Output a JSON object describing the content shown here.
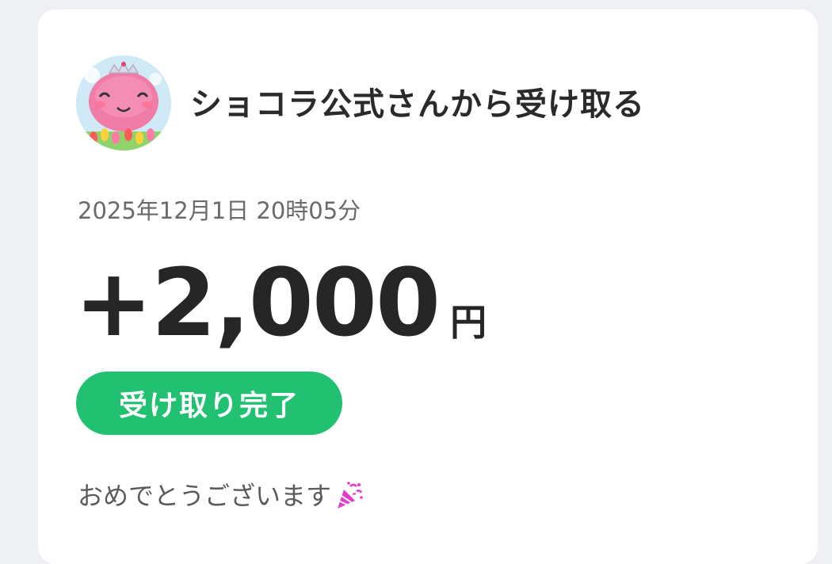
{
  "transfer": {
    "sender_label": "ショコラ公式さんから受け取る",
    "datetime": "2025年12月1日 20時05分",
    "amount": "+2,000",
    "currency": "円",
    "status": "受け取り完了",
    "message": "おめでとうございます",
    "message_emoji": "party-popper-icon"
  },
  "colors": {
    "status_green": "#22c172",
    "background": "#eef0f3",
    "card": "#ffffff"
  }
}
